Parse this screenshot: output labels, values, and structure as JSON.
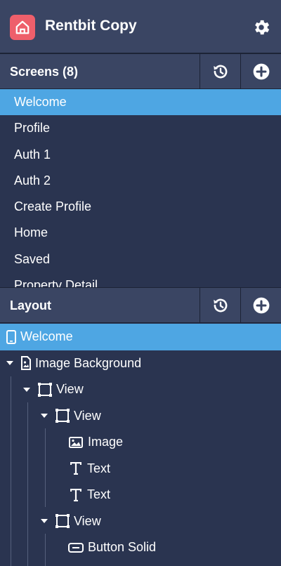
{
  "app": {
    "title": "Rentbit Copy",
    "brand_color": "#ee5f6b",
    "accent_color": "#4ea6e3",
    "logo_icon": "house-icon",
    "settings_icon": "gear-icon"
  },
  "screens": {
    "title": "Screens (8)",
    "history_icon": "history-icon",
    "add_icon": "add-circle-icon",
    "items": [
      {
        "label": "Welcome",
        "selected": true
      },
      {
        "label": "Profile"
      },
      {
        "label": "Auth 1"
      },
      {
        "label": "Auth 2"
      },
      {
        "label": "Create Profile"
      },
      {
        "label": "Home"
      },
      {
        "label": "Saved"
      },
      {
        "label": "Property Detail"
      }
    ]
  },
  "layout": {
    "title": "Layout",
    "history_icon": "history-icon",
    "add_icon": "add-circle-icon",
    "tree": [
      {
        "label": "Welcome",
        "icon": "phone-icon",
        "depth": 0,
        "selected": true
      },
      {
        "label": "Image Background",
        "icon": "image-file-icon",
        "depth": 0,
        "expanded": true
      },
      {
        "label": "View",
        "icon": "view-frame-icon",
        "depth": 1,
        "expanded": true
      },
      {
        "label": "View",
        "icon": "view-frame-icon",
        "depth": 2,
        "expanded": true
      },
      {
        "label": "Image",
        "icon": "image-icon",
        "depth": 3
      },
      {
        "label": "Text",
        "icon": "text-icon",
        "depth": 3
      },
      {
        "label": "Text",
        "icon": "text-icon",
        "depth": 3
      },
      {
        "label": "View",
        "icon": "view-frame-icon",
        "depth": 2,
        "expanded": true
      },
      {
        "label": "Button Solid",
        "icon": "button-icon",
        "depth": 3
      }
    ]
  }
}
